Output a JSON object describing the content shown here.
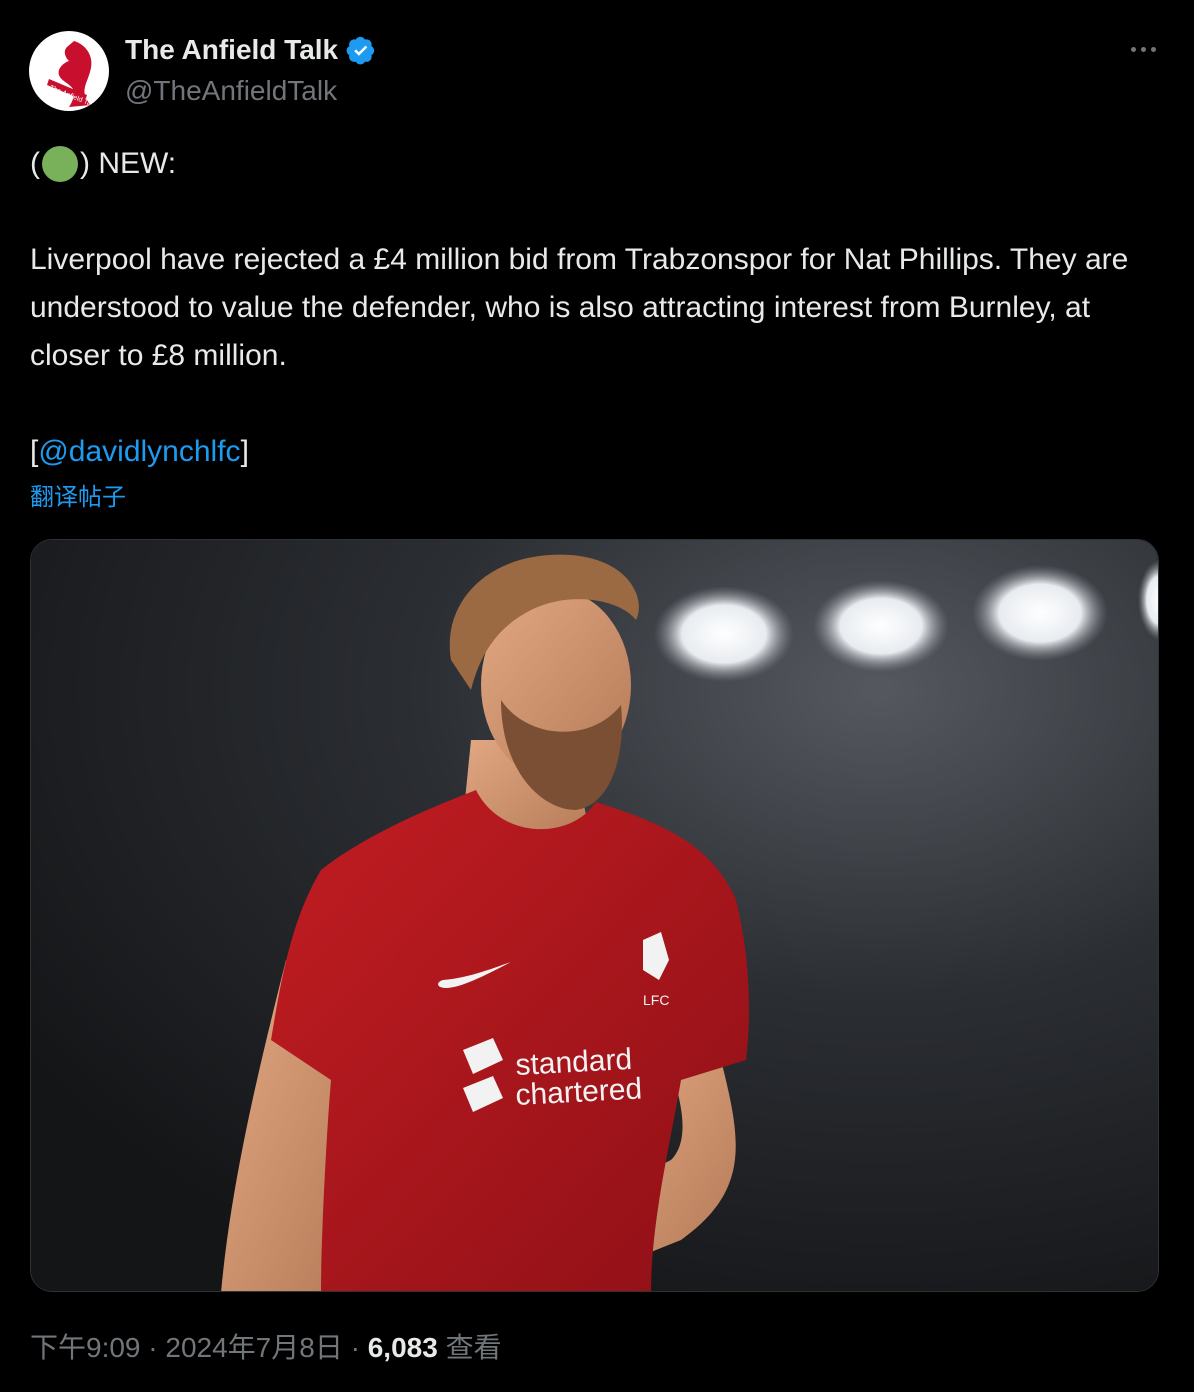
{
  "tweet": {
    "author": {
      "display_name": "The Anfield Talk",
      "handle": "@TheAnfieldTalk",
      "avatar_text": "The Anfield Talk",
      "verified": true
    },
    "text": {
      "open_paren": "(",
      "close_new": ") NEW:",
      "body": "Liverpool have rejected a £4 million bid from Trabzonspor for Nat Phillips. They are understood to value the defender, who is also attracting interest from Burnley, at closer to £8 million.",
      "bracket_open": "[",
      "mention": "@davidlynchlfc",
      "bracket_close": "]"
    },
    "translate_label": "翻译帖子",
    "media": {
      "shirt_sponsor_line1": "standard",
      "shirt_sponsor_line2": "chartered",
      "crest_text": "LFC"
    },
    "meta": {
      "time": "下午9:09",
      "separator1": " · ",
      "date": "2024年7月8日",
      "separator2": " · ",
      "views_count": "6,083",
      "views_label": " 查看"
    }
  },
  "colors": {
    "background": "#000000",
    "text": "#e7e9ea",
    "secondary": "#71767b",
    "link": "#1d9bf0",
    "verified": "#1d9bf0",
    "emoji_green": "#78b159",
    "shirt_red": "#b3151c"
  },
  "icons": {
    "verified": "verified-badge-icon",
    "more": "more-dots-icon"
  }
}
